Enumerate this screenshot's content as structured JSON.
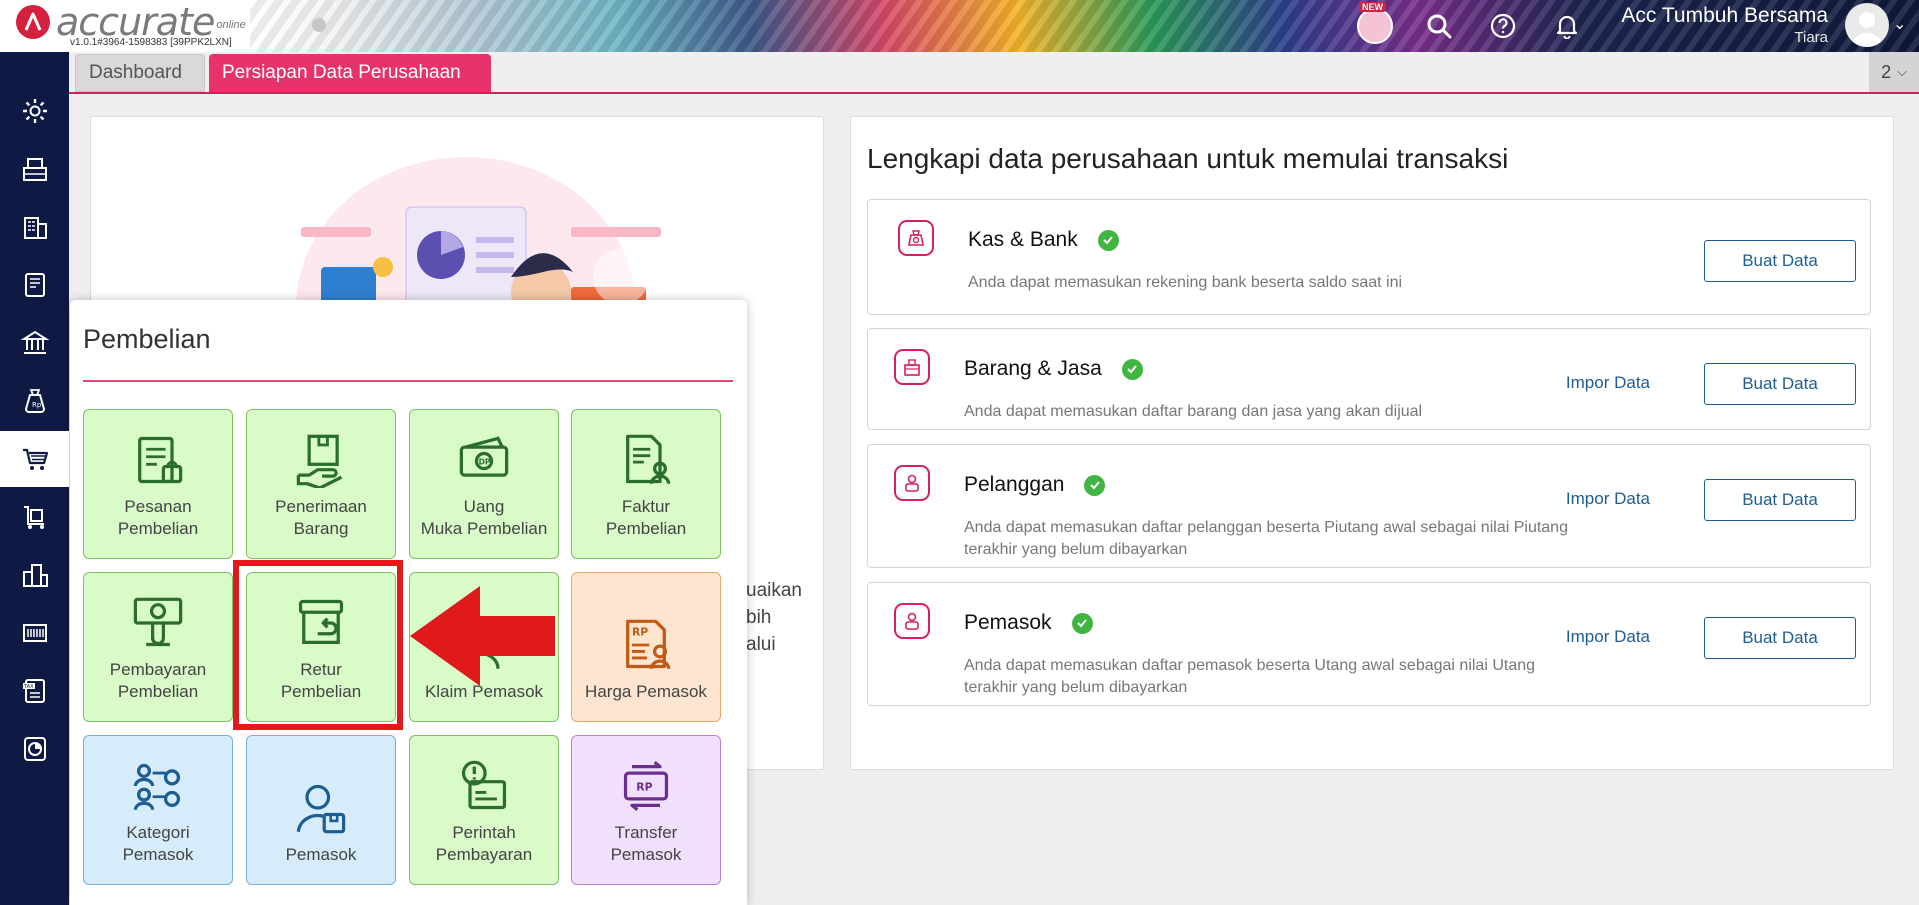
{
  "header": {
    "logo_text": "accurate",
    "logo_sub": "online",
    "version": "v1.0.1#3964-1598383 [39PPK2LXN]",
    "new_badge": "NEW",
    "company_name": "Acc Tumbuh Bersama",
    "user_name": "Tiara"
  },
  "sidebar": {
    "items": [
      "gear-icon",
      "cashier-icon",
      "building-icon",
      "book-icon",
      "bank-icon",
      "money-bag-icon",
      "cart-icon",
      "trolley-icon",
      "city-icon",
      "barcode-icon",
      "tax-icon",
      "report-icon"
    ],
    "active_index": 6
  },
  "tabs": {
    "items": [
      "Dashboard",
      "Persiapan Data Perusahaan"
    ],
    "active": "Persiapan Data Perusahaan",
    "count": "2"
  },
  "left_card": {
    "partial_lines": [
      "uaikan",
      "bih",
      "alui"
    ]
  },
  "right_card": {
    "title": "Lengkapi data perusahaan untuk memulai transaksi",
    "items": [
      {
        "title": "Kas & Bank",
        "desc": "Anda dapat memasukan rekening bank beserta saldo saat ini",
        "impor": "",
        "buat": "Buat Data"
      },
      {
        "title": "Barang & Jasa",
        "desc": "Anda dapat memasukan daftar barang dan jasa yang akan dijual",
        "impor": "Impor Data",
        "buat": "Buat Data"
      },
      {
        "title": "Pelanggan",
        "desc": "Anda dapat memasukan daftar pelanggan beserta Piutang awal sebagai nilai Piutang terakhir yang belum dibayarkan",
        "impor": "Impor Data",
        "buat": "Buat Data"
      },
      {
        "title": "Pemasok",
        "desc": "Anda dapat memasukan daftar pemasok beserta Utang awal sebagai nilai Utang terakhir yang belum dibayarkan",
        "impor": "Impor Data",
        "buat": "Buat Data"
      }
    ]
  },
  "popup": {
    "title": "Pembelian",
    "tiles": [
      {
        "label": "Pesanan Pembelian",
        "color": "green",
        "icon": "order-doc-icon"
      },
      {
        "label": "Penerimaan Barang",
        "color": "green",
        "icon": "receive-box-icon"
      },
      {
        "label": "Uang Muka Pembelian",
        "color": "green",
        "icon": "down-payment-icon"
      },
      {
        "label": "Faktur Pembelian",
        "color": "green",
        "icon": "invoice-icon"
      },
      {
        "label": "Pembayaran Pembelian",
        "color": "green",
        "icon": "payment-icon"
      },
      {
        "label": "Retur Pembelian",
        "color": "green",
        "icon": "return-box-icon"
      },
      {
        "label": "Klaim Pemasok",
        "color": "green",
        "icon": "claim-icon"
      },
      {
        "label": "Harga Pemasok",
        "color": "orange",
        "icon": "price-list-icon"
      },
      {
        "label": "Kategori Pemasok",
        "color": "blue",
        "icon": "category-icon"
      },
      {
        "label": "Pemasok",
        "color": "blue",
        "icon": "supplier-icon"
      },
      {
        "label": "Perintah Pembayaran",
        "color": "green",
        "icon": "payment-order-icon"
      },
      {
        "label": "Transfer Pemasok",
        "color": "purple",
        "icon": "transfer-icon"
      }
    ]
  },
  "colors": {
    "brand": "#d6203f",
    "tab_active": "#e8326b",
    "sidebar_bg": "#0f1a44",
    "link": "#1d5d94",
    "check": "#41b541",
    "highlight": "#e01a1a"
  }
}
